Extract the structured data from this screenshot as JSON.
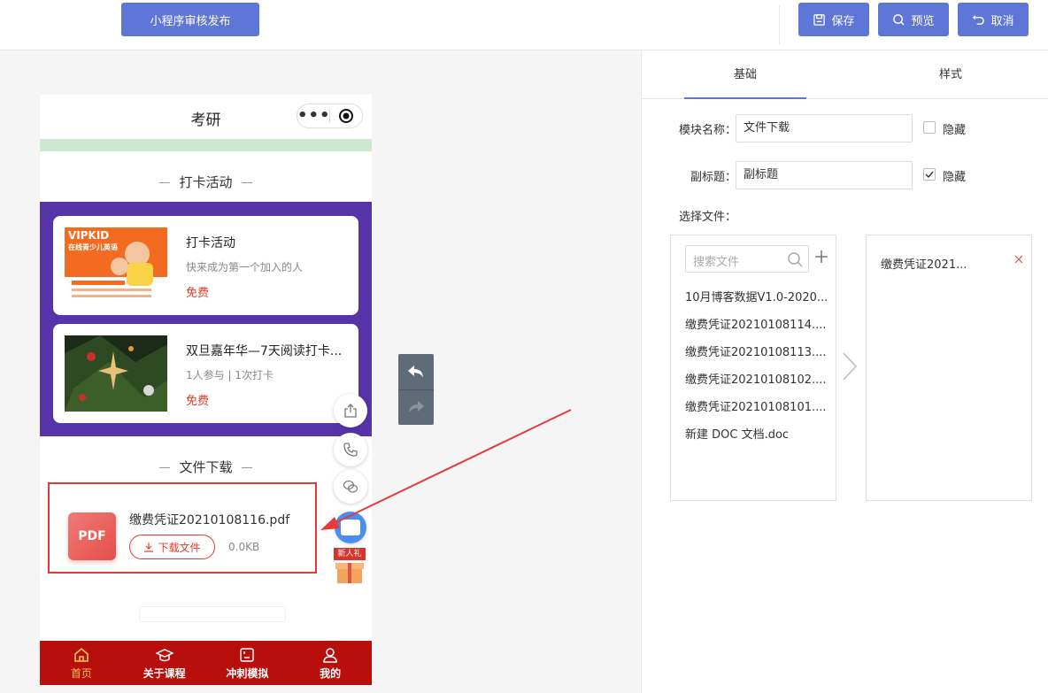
{
  "topbar": {
    "publish_label": "小程序审核发布",
    "save_label": "保存",
    "preview_label": "预览",
    "cancel_label": "取消"
  },
  "phone": {
    "title": "考研",
    "capsule_dots": "•••",
    "checkin_section_title": "打卡活动",
    "cards": [
      {
        "name": "打卡活动",
        "sub": "快来成为第一个加入的人",
        "price": "免费",
        "image_text_brand": "VIPKID",
        "image_text_line": "在线青少儿英语"
      },
      {
        "name": "双旦嘉年华—7天阅读打卡...",
        "sub": "1人参与 | 1次打卡",
        "price": "免费"
      }
    ],
    "file_section_title": "文件下载",
    "file": {
      "name": "缴费凭证20210108116.pdf",
      "icon_text": "PDF",
      "download_label": "下载文件",
      "size": "0.0KB"
    },
    "gift_label": "新人礼",
    "tabs": [
      {
        "label": "首页",
        "icon": "home-icon",
        "active": true
      },
      {
        "label": "关于课程",
        "icon": "graduation-cap-icon",
        "active": false
      },
      {
        "label": "冲刺模拟",
        "icon": "exam-icon",
        "active": false
      },
      {
        "label": "我的",
        "icon": "user-icon",
        "active": false
      }
    ]
  },
  "panel": {
    "tabs": [
      "基础",
      "样式"
    ],
    "module_name_label": "模块名称：",
    "module_name_value": "文件下载",
    "module_hide_label": "隐藏",
    "module_hide_checked": false,
    "subtitle_label": "副标题：",
    "subtitle_value": "副标题",
    "subtitle_hide_label": "隐藏",
    "subtitle_hide_checked": true,
    "select_files_label": "选择文件：",
    "search_placeholder": "搜索文件",
    "files": [
      "10月博客数据V1.0-2020...",
      "缴费凭证20210108114....",
      "缴费凭证20210108113....",
      "缴费凭证20210108102....",
      "缴费凭证20210108101....",
      "新建 DOC 文档.doc"
    ],
    "selected_files": [
      "缴费凭证2021..."
    ]
  },
  "colors": {
    "primary": "#5f76d9",
    "purple": "#5633a8",
    "tabbar": "#b80e0c",
    "accent_red": "#e53a2a",
    "highlight": "#e43a3a"
  }
}
